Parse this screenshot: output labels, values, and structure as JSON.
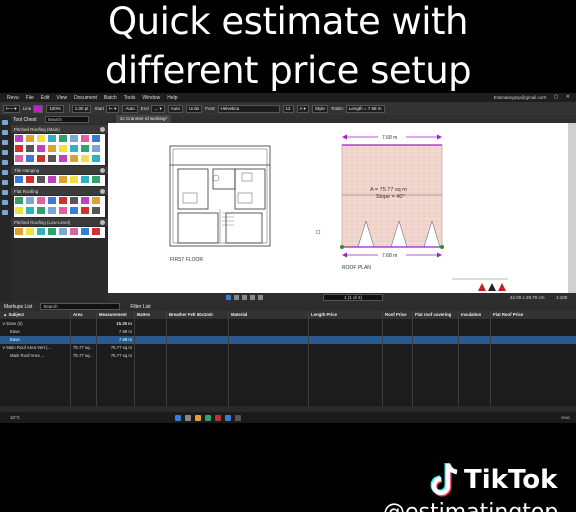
{
  "caption": {
    "line1": "Quick estimate with",
    "line2": "different price setup"
  },
  "menu": {
    "items": [
      "Revu",
      "File",
      "Edit",
      "View",
      "Document",
      "Batch",
      "Tools",
      "Window",
      "Help"
    ],
    "email": "Estimatingtop@gmail.com"
  },
  "toolbar": {
    "line_label": "Line",
    "zoom": "100%",
    "line_width": "1.00 pt",
    "start_label": "Start",
    "start_value": "Auto",
    "end_label": "End",
    "end_value": "Auto",
    "units": "Units",
    "font_label": "Font:",
    "font_value": "Helvetica",
    "font_size": "12",
    "style_label": "Style",
    "totals_label": "Totals:",
    "totals_value": "Length = 7.68 m"
  },
  "toolchest": {
    "title": "Tool Chest",
    "search_placeholder": "Search",
    "sections": [
      "Pitched Roofing (Main)",
      "Tile Hanging",
      "Flat Roofing",
      "Pitched Roofing (Low Level)"
    ]
  },
  "document_tab": "2c Cranmer rd working*",
  "drawing": {
    "first_floor_label": "FIRST FLOOR",
    "roof_plan_label": "ROOF PLAN",
    "top_dim": "7.68 m",
    "bottom_dim": "7.68 m",
    "area_text": "A = 75.77 sq m",
    "slope_text": "Slope = 40°"
  },
  "nav": {
    "page": "1 (1 of 2)",
    "dims": "42.00 x 29.70 cm",
    "scale": "1:100"
  },
  "markups": {
    "title": "Markups List",
    "search_placeholder": "Search",
    "filter_label": "Filter List",
    "columns": [
      "Subject",
      "Area",
      "Measurement",
      "Batten",
      "Breather Felt 50x1mtr",
      "Material",
      "Length Price",
      "Roof Price",
      "Flat roof covering",
      "Insulation",
      "Flat Roof Price"
    ],
    "rows": [
      {
        "subject": "Eave (2)",
        "area": "",
        "measurement": "15.35 m"
      },
      {
        "subject": "Eave",
        "area": "",
        "measurement": "7.68 m"
      },
      {
        "subject": "Eave",
        "area": "",
        "measurement": "7.68 m"
      },
      {
        "subject": "Main Roof Area Vert (...",
        "area": "75.77 sq...",
        "measurement": "75.77 sq m"
      },
      {
        "subject": "Main Roof Area ...",
        "area": "75.77 sq...",
        "measurement": "75.77 sq m"
      }
    ]
  },
  "taskbar": {
    "weather": "10°C",
    "lang": "ENG"
  },
  "watermark": {
    "brand": "TikTok",
    "cut_text": "@estimatingtop"
  },
  "colors": {
    "accent": "#3a7bd5",
    "dimension": "#a020c0",
    "roof_fill": "#f2d9d2"
  }
}
